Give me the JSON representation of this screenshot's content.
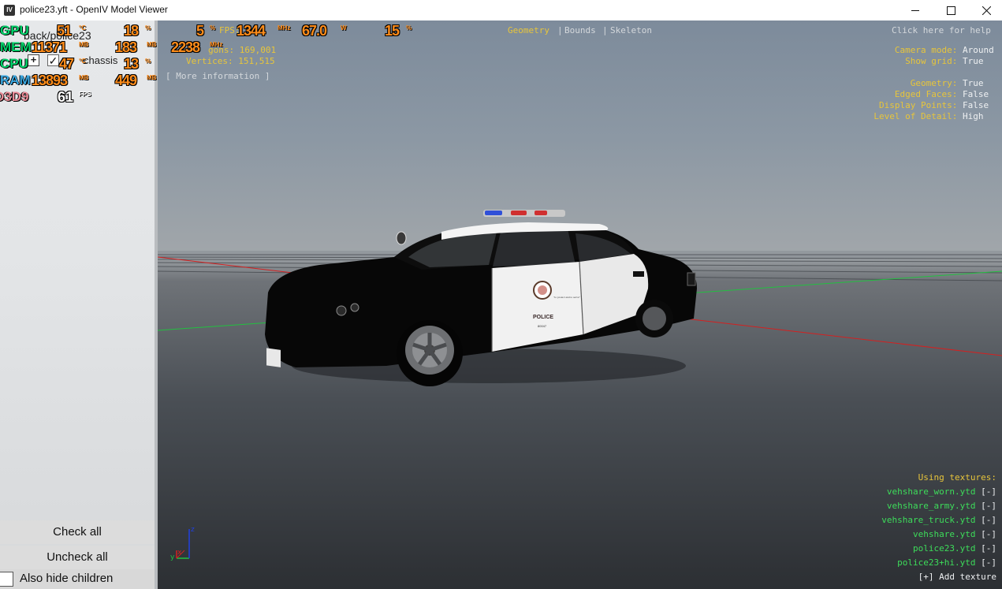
{
  "window": {
    "title": "police23.yft - OpenIV Model Viewer",
    "icon": "openiv-app-icon"
  },
  "left_panel": {
    "tree_path": "back/police23",
    "tree_item_label": "chassis",
    "check_all": "Check all",
    "uncheck_all": "Uncheck all",
    "also_hide_children": "Also hide children"
  },
  "overlay": {
    "gpu": {
      "label": "GPU",
      "temp": "51",
      "temp_unit": "°C",
      "load": "18",
      "load_unit": "%"
    },
    "mem": {
      "label": "MEM",
      "value": "11371",
      "value_unit": "MB",
      "value2": "183",
      "value2_unit": "MB"
    },
    "cpu": {
      "label": "CPU",
      "value": "47",
      "value_unit": "°C",
      "load": "13",
      "load_unit": "%"
    },
    "ram": {
      "label": "RAM",
      "value": "13893",
      "value_unit": "MB",
      "value2": "449",
      "value2_unit": "MB"
    },
    "d3d": {
      "label": "D3D9",
      "fps": "61",
      "fps_unit": "FPS"
    },
    "gpu2": {
      "v1": "5",
      "v1_unit": "%",
      "clock": "1344",
      "clock_unit": "MHz",
      "volt": "67.0",
      "volt_unit": "W",
      "v4": "15",
      "v4_unit": "%"
    },
    "mem2": {
      "clock": "2238",
      "clock_unit": "MHz"
    }
  },
  "viewport": {
    "fps_label": "FPS:",
    "polygons": "gons: 169,001",
    "vertices": "Vertices: 151,515",
    "more_info": "[ More information ]",
    "tabs": {
      "geometry": "Geometry",
      "bounds": "Bounds",
      "skeleton": "Skeleton",
      "sep": "|"
    },
    "help": "Click here for help",
    "settings": [
      {
        "key": "Camera mode:",
        "value": "Around"
      },
      {
        "key": "Show grid:",
        "value": "True"
      },
      {
        "key": "Geometry:",
        "value": "True"
      },
      {
        "key": "Edged Faces:",
        "value": "False"
      },
      {
        "key": "Display Points:",
        "value": "False"
      },
      {
        "key": "Level of Detail:",
        "value": "High"
      }
    ],
    "using_textures": "Using textures:",
    "textures": [
      {
        "name": "vehshare_worn.ytd",
        "toggle": "[-]"
      },
      {
        "name": "vehshare_army.ytd",
        "toggle": "[-]"
      },
      {
        "name": "vehshare_truck.ytd",
        "toggle": "[-]"
      },
      {
        "name": "vehshare.ytd",
        "toggle": "[-]"
      },
      {
        "name": "police23.ytd",
        "toggle": "[-]"
      },
      {
        "name": "police23+hi.ytd",
        "toggle": "[-]"
      }
    ],
    "add_texture": "[+] Add texture",
    "car_text": {
      "police": "POLICE",
      "motto": "\"to protect and to serve\"",
      "unit": "80047"
    },
    "axis": {
      "z": "z",
      "x": "x",
      "y": "y"
    },
    "colors": {
      "axis_x": "#d42020",
      "axis_y": "#22c040",
      "axis_z": "#2040e0",
      "label_yellow": "#e7c53b",
      "texture_green": "#3ddc5a"
    }
  }
}
